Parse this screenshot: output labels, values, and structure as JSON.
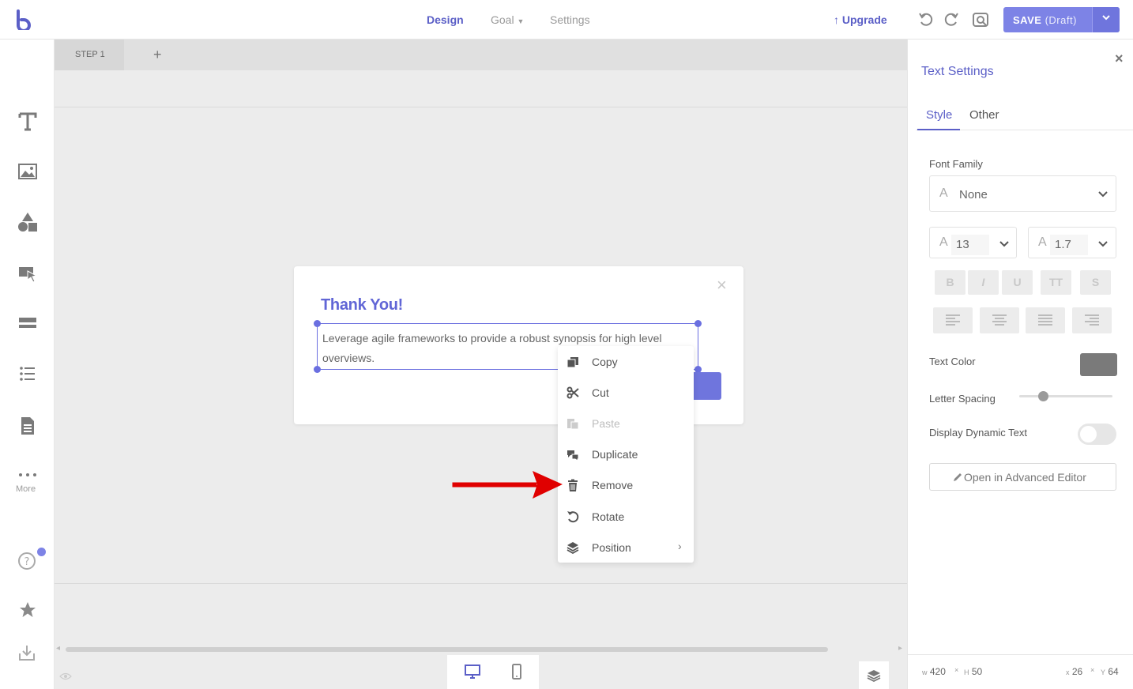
{
  "topbar": {
    "nav": {
      "design": "Design",
      "goal": "Goal",
      "settings": "Settings"
    },
    "upgrade": "Upgrade",
    "save_label": "SAVE",
    "save_status": "(Draft)"
  },
  "sidebar": {
    "more_label": "More",
    "icons": [
      "text-icon",
      "image-icon",
      "shapes-icon",
      "button-cursor-icon",
      "form-field-icon",
      "list-icon",
      "document-icon",
      "more-dots-icon",
      "help-icon",
      "star-icon",
      "download-icon"
    ]
  },
  "canvas": {
    "step_tab": "STEP 1",
    "add_step": "+"
  },
  "popup": {
    "close": "×",
    "title": "Thank You!",
    "text": "Leverage agile frameworks to provide a robust synopsis for high level overviews."
  },
  "context_menu": {
    "items": [
      {
        "label": "Copy",
        "icon": "copy-icon",
        "disabled": false
      },
      {
        "label": "Cut",
        "icon": "scissors-icon",
        "disabled": false
      },
      {
        "label": "Paste",
        "icon": "paste-icon",
        "disabled": true
      },
      {
        "label": "Duplicate",
        "icon": "duplicate-icon",
        "disabled": false
      },
      {
        "label": "Remove",
        "icon": "trash-icon",
        "disabled": false
      },
      {
        "label": "Rotate",
        "icon": "rotate-icon",
        "disabled": false
      },
      {
        "label": "Position",
        "icon": "layers-icon",
        "disabled": false,
        "submenu": "›"
      }
    ]
  },
  "panel": {
    "close": "×",
    "title": "Text Settings",
    "tabs": {
      "style": "Style",
      "other": "Other"
    },
    "font_family_label": "Font Family",
    "font_family_value": "None",
    "font_size": "13",
    "line_height": "1.7",
    "format_buttons": [
      "B",
      "I",
      "U",
      "TT",
      "S"
    ],
    "text_color_label": "Text Color",
    "text_color": "#7a7a7a",
    "letter_spacing_label": "Letter Spacing",
    "letter_spacing_level": 0.25,
    "dynamic_text_label": "Display Dynamic Text",
    "dynamic_text_on": false,
    "advanced_editor": "Open in Advanced Editor",
    "footer": {
      "w_label": "w",
      "w": "420",
      "h_label": "H",
      "h": "50",
      "x_label": "x",
      "x": "26",
      "y_label": "Y",
      "y": "64",
      "sep": "×"
    }
  },
  "colors": {
    "accent": "#5b5fc7",
    "button": "#7d83e6",
    "arrow": "#e00000"
  }
}
